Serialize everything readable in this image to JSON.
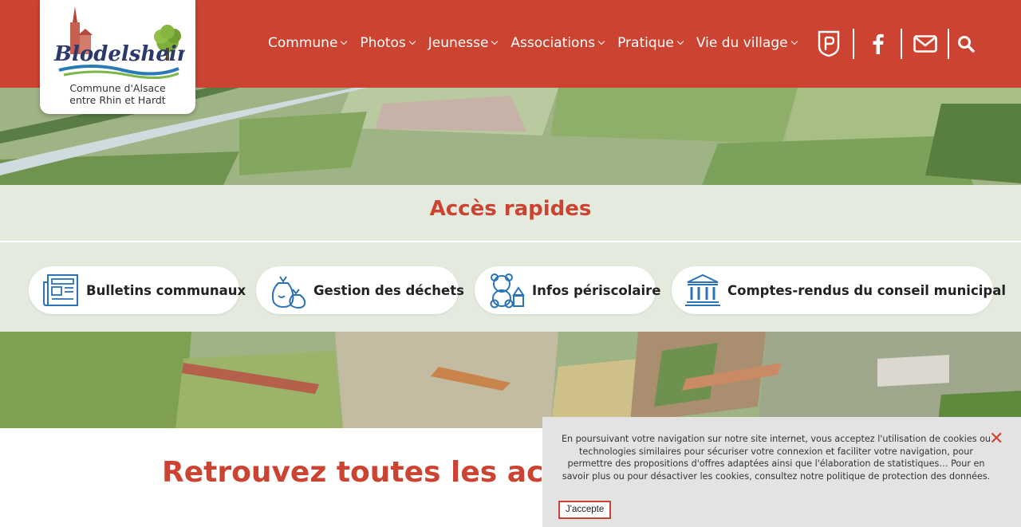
{
  "header": {
    "logo_text": "Blodelsheim",
    "logo_subtitle_line1": "Commune d'Alsace",
    "logo_subtitle_line2": "entre Rhin et Hardt",
    "nav": [
      {
        "label": "Commune"
      },
      {
        "label": "Photos"
      },
      {
        "label": "Jeunesse"
      },
      {
        "label": "Associations"
      },
      {
        "label": "Pratique"
      },
      {
        "label": "Vie du village"
      }
    ],
    "icons": [
      "panneaupocket-icon",
      "facebook-icon",
      "mail-icon",
      "search-icon"
    ],
    "brand_color": "#cc4431"
  },
  "quick_access": {
    "title": "Accès rapides",
    "items": [
      {
        "label": "Bulletins communaux",
        "icon": "newspaper-icon"
      },
      {
        "label": "Gestion des déchets",
        "icon": "garbage-bags-icon"
      },
      {
        "label": "Infos périscolaire",
        "icon": "teddy-bear-icon"
      },
      {
        "label": "Comptes-rendus du conseil municipal",
        "icon": "town-hall-icon"
      }
    ]
  },
  "news": {
    "title": "Retrouvez toutes les actus d"
  },
  "cookie_banner": {
    "text": "En poursuivant votre navigation sur notre site internet, vous acceptez l'utilisation de cookies ou technologies similaires pour sécuriser votre connexion et faciliter votre navigation, pour permettre des propositions d'offres adaptées ainsi que l'élaboration de statistiques… Pour en savoir plus ou pour désactiver les cookies, consultez notre politique de protection des données.",
    "accept_label": "J'accepte",
    "close_symbol": "✕"
  }
}
